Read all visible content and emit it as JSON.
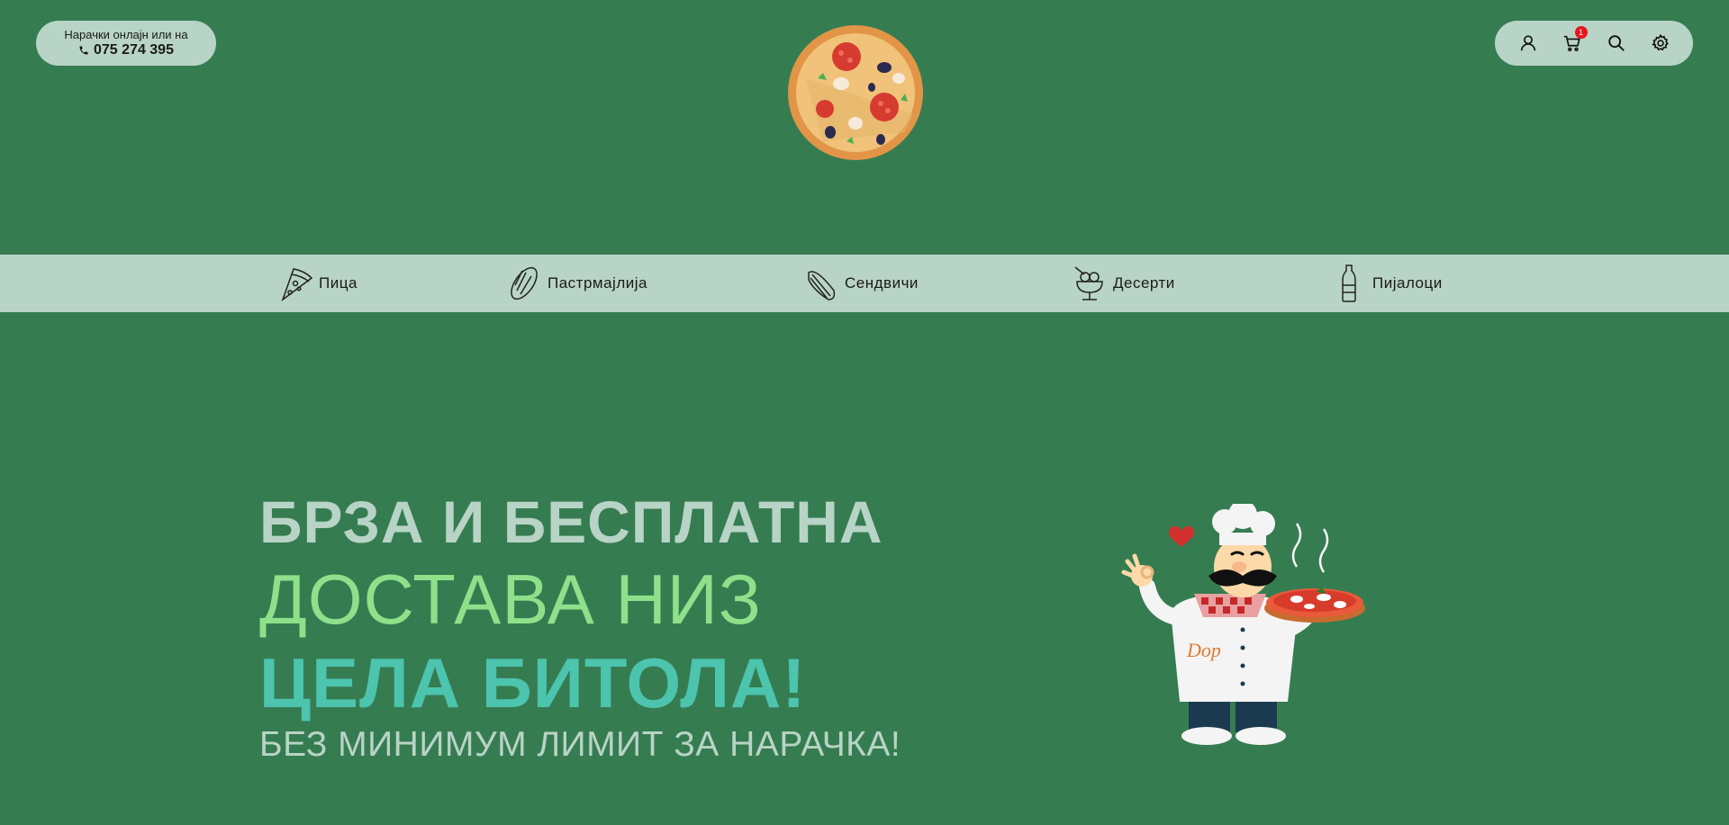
{
  "header": {
    "phone_caption": "Нарачки онлајн или на",
    "phone_number": "075 274 395",
    "cart_count": "1"
  },
  "categories": [
    {
      "label": "Пица",
      "icon": "pizza-slice-icon"
    },
    {
      "label": "Пастрмајлија",
      "icon": "pastrmajlija-icon"
    },
    {
      "label": "Сендвичи",
      "icon": "sandwich-icon"
    },
    {
      "label": "Десерти",
      "icon": "dessert-icon"
    },
    {
      "label": "Пијалоци",
      "icon": "bottle-icon"
    }
  ],
  "hero": {
    "line1": "БРЗА И БЕСПЛАТНА",
    "line2": "ДОСТАВА НИЗ",
    "line3": "ЦЕЛА БИТОЛА!",
    "line4": "БЕЗ МИНИМУМ ЛИМИТ ЗА НАРАЧКА!"
  },
  "colors": {
    "background": "#367c51",
    "pill": "#b8d4c6",
    "hero_green": "#8fe08a",
    "hero_teal": "#4cc4ae",
    "badge": "#e8161c"
  }
}
